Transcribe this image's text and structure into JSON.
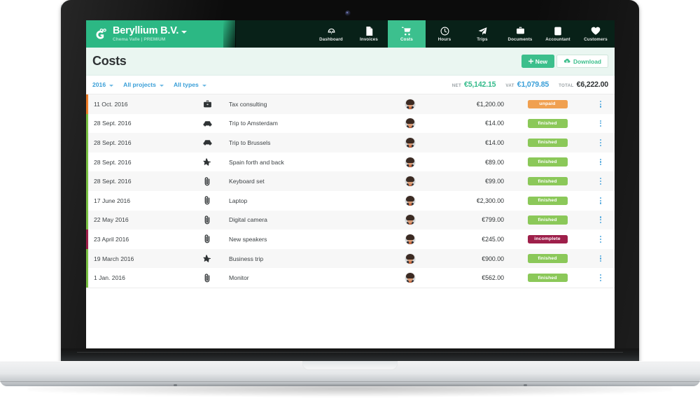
{
  "app": {
    "brand_name": "Beryllium B.V.",
    "brand_sub": "Chema Valle | PREMIUM",
    "logo_icon": "owl-g-logo-icon",
    "brand_caret_icon": "caret-down-icon"
  },
  "nav": {
    "items": [
      {
        "label": "Dashboard",
        "icon": "dashboard-gauge-icon",
        "active": false
      },
      {
        "label": "Invoices",
        "icon": "document-icon",
        "active": false
      },
      {
        "label": "Costs",
        "icon": "shopping-cart-icon",
        "active": true
      },
      {
        "label": "Hours",
        "icon": "clock-icon",
        "active": false
      },
      {
        "label": "Trips",
        "icon": "paper-plane-icon",
        "active": false
      },
      {
        "label": "Documents",
        "icon": "briefcase-icon",
        "active": false
      },
      {
        "label": "Accountant",
        "icon": "calculator-icon",
        "active": false
      },
      {
        "label": "Customers",
        "icon": "heart-icon",
        "active": false
      }
    ]
  },
  "page": {
    "title": "Costs",
    "new_button": "New",
    "new_icon": "plus-icon",
    "download_button": "Download",
    "download_icon": "cloud-download-icon"
  },
  "filters": [
    {
      "label": "2016",
      "icon": "caret-down-icon"
    },
    {
      "label": "All projects",
      "icon": "caret-down-icon"
    },
    {
      "label": "All types",
      "icon": "caret-down-icon"
    }
  ],
  "totals": [
    {
      "label": "NET",
      "value": "€5,142.15",
      "color": "#35bb8b"
    },
    {
      "label": "VAT",
      "value": "€1,079.85",
      "color": "#3a9fd8"
    },
    {
      "label": "TOTAL",
      "value": "€6,222.00",
      "color": "#2f3335"
    }
  ],
  "colors": {
    "brand_green": "#2cb884",
    "nav_active_green": "#3cc08e",
    "header_tint": "#eaf6f1",
    "link_blue": "#3a9fd8",
    "badge_unpaid": "#f0a050",
    "badge_finished": "#8bc859",
    "badge_incomplete": "#9e1f4a",
    "bar_orange": "#f07d28",
    "bar_green": "#7ac143",
    "bar_maroon": "#9e1f4a"
  },
  "table": {
    "rows": [
      {
        "date": "11 Oct. 2016",
        "icon": "briefcase-icon",
        "description": "Tax consulting",
        "amount": "€1,200.00",
        "status": "unpaid",
        "status_color": "#f0a050",
        "bar_color": "#f07d28",
        "avatar": "user-avatar"
      },
      {
        "date": "28 Sept. 2016",
        "icon": "car-icon",
        "description": "Trip to Amsterdam",
        "amount": "€14.00",
        "status": "finished",
        "status_color": "#8bc859",
        "bar_color": "#7ac143",
        "avatar": "user-avatar"
      },
      {
        "date": "28 Sept. 2016",
        "icon": "car-icon",
        "description": "Trip to Brussels",
        "amount": "€14.00",
        "status": "finished",
        "status_color": "#8bc859",
        "bar_color": "#7ac143",
        "avatar": "user-avatar"
      },
      {
        "date": "28 Sept. 2016",
        "icon": "plane-icon",
        "description": "Spain forth and back",
        "amount": "€89.00",
        "status": "finished",
        "status_color": "#8bc859",
        "bar_color": "#7ac143",
        "avatar": "user-avatar"
      },
      {
        "date": "28 Sept. 2016",
        "icon": "paperclip-icon",
        "description": "Keyboard set",
        "amount": "€99.00",
        "status": "finished",
        "status_color": "#8bc859",
        "bar_color": "#7ac143",
        "avatar": "user-avatar"
      },
      {
        "date": "17 June 2016",
        "icon": "paperclip-icon",
        "description": "Laptop",
        "amount": "€2,300.00",
        "status": "finished",
        "status_color": "#8bc859",
        "bar_color": "#7ac143",
        "avatar": "user-avatar"
      },
      {
        "date": "22 May 2016",
        "icon": "paperclip-icon",
        "description": "Digital camera",
        "amount": "€799.00",
        "status": "finished",
        "status_color": "#8bc859",
        "bar_color": "#7ac143",
        "avatar": "user-avatar"
      },
      {
        "date": "23 April 2016",
        "icon": "paperclip-icon",
        "description": "New speakers",
        "amount": "€245.00",
        "status": "incomplete",
        "status_color": "#9e1f4a",
        "bar_color": "#9e1f4a",
        "avatar": "user-avatar"
      },
      {
        "date": "19 March 2016",
        "icon": "plane-icon",
        "description": "Business trip",
        "amount": "€900.00",
        "status": "finished",
        "status_color": "#8bc859",
        "bar_color": "#7ac143",
        "avatar": "user-avatar"
      },
      {
        "date": "1 Jan. 2016",
        "icon": "paperclip-icon",
        "description": "Monitor",
        "amount": "€562.00",
        "status": "finished",
        "status_color": "#8bc859",
        "bar_color": "#7ac143",
        "avatar": "user-avatar"
      }
    ],
    "row_menu_icon": "kebab-menu-icon"
  },
  "device": {
    "type": "laptop-mockup",
    "webcam": "webcam-icon"
  }
}
